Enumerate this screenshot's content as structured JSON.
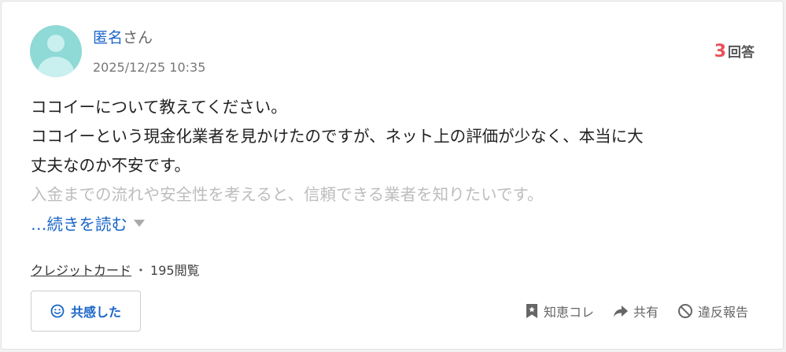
{
  "user": {
    "name": "匿名",
    "suffix": "さん",
    "timestamp": "2025/12/25 10:35"
  },
  "answers": {
    "count": "3",
    "label": "回答"
  },
  "question": {
    "lines": [
      "ココイーについて教えてください。",
      "ココイーという現金化業者を見かけたのですが、ネット上の評価が少なく、本当に大",
      "丈夫なのか不安です。"
    ],
    "faded_line": "入金までの流れや安全性を考えると、信頼できる業者を知りたいです。",
    "read_more": "…続きを読む"
  },
  "meta": {
    "category": "クレジットカード",
    "separator": "・",
    "views": "195閲覧"
  },
  "buttons": {
    "empathy": "共感した",
    "chiebukuro_kore": "知恵コレ",
    "share": "共有",
    "report": "違反報告"
  },
  "colors": {
    "link": "#1a66c9",
    "answer_count": "#e8515a",
    "avatar": "#8fd9d6"
  },
  "icons": {
    "empathy": "smile-icon",
    "collection": "bookmark-star-icon",
    "share": "share-arrow-icon",
    "report": "prohibited-icon"
  }
}
